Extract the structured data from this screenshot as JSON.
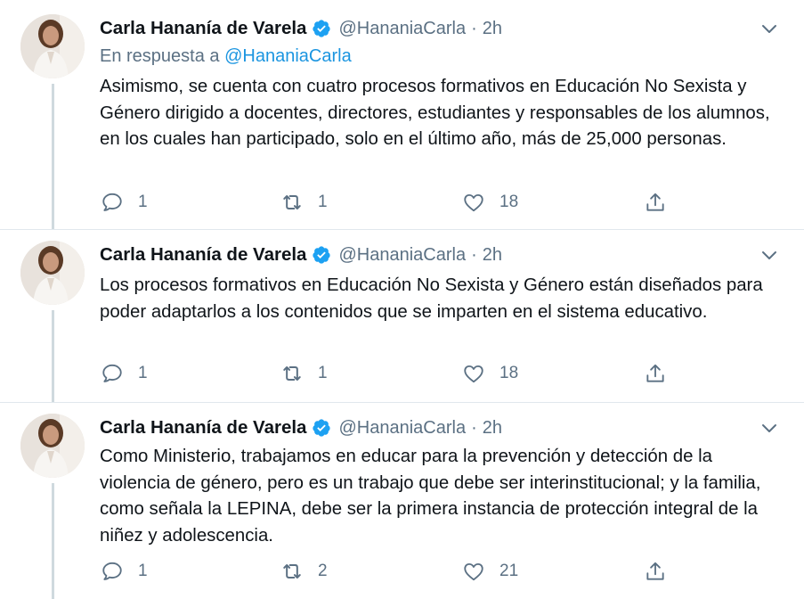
{
  "colors": {
    "text": "#0f1419",
    "secondary": "#5b7083",
    "link": "#1b95e0",
    "verified": "#1da1f2",
    "line": "#cfd9de"
  },
  "tweets": [
    {
      "name": "Carla Hananía de Varela",
      "handle": "@HananiaCarla",
      "dot": "·",
      "time": "2h",
      "reply_prefix": "En respuesta a",
      "reply_mention": "@HananiaCarla",
      "text": "Asimismo, se cuenta con cuatro procesos formativos en Educación No Sexista y Género dirigido a docentes, directores, estudiantes y responsables de los alumnos, en los cuales han participado, solo en el último año, más de 25,000 personas.",
      "replies": "1",
      "retweets": "1",
      "likes": "18"
    },
    {
      "name": "Carla Hananía de Varela",
      "handle": "@HananiaCarla",
      "dot": "·",
      "time": "2h",
      "text": "Los procesos formativos en Educación No Sexista y Género están diseñados para poder adaptarlos a los contenidos que se imparten en el sistema educativo.",
      "replies": "1",
      "retweets": "1",
      "likes": "18"
    },
    {
      "name": "Carla Hananía de Varela",
      "handle": "@HananiaCarla",
      "dot": "·",
      "time": "2h",
      "text": "Como Ministerio, trabajamos en educar para la prevención y detección de la violencia de género, pero es un trabajo que debe ser interinstitucional; y la familia, como señala la LEPINA, debe ser la primera instancia de protección integral de la niñez y adolescencia.",
      "replies": "1",
      "retweets": "2",
      "likes": "21"
    }
  ]
}
